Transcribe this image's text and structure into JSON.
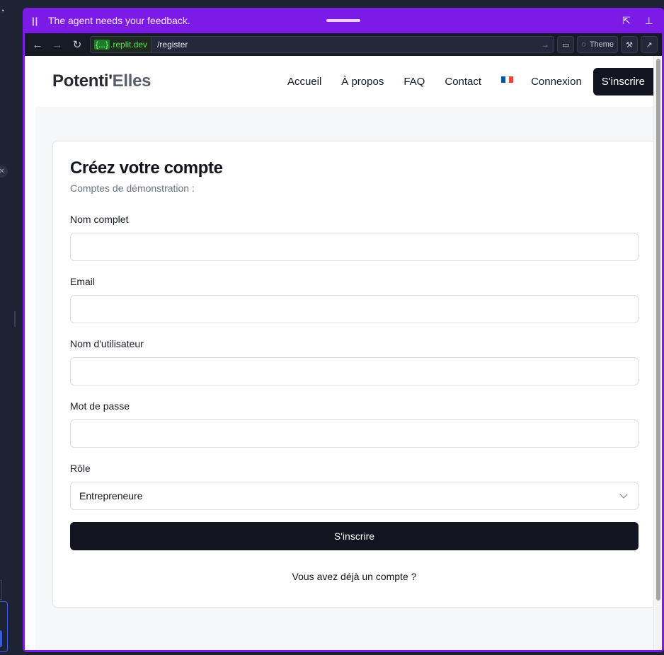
{
  "agent_bar": {
    "message": "The agent needs your feedback."
  },
  "browser": {
    "domain_brace": "{...}",
    "domain_suffix": ".replit.dev",
    "path": "/register",
    "theme_label": "Theme"
  },
  "site": {
    "logo_main": "Potenti'",
    "logo_tail": "Elles",
    "nav": {
      "home": "Accueil",
      "about": "À propos",
      "faq": "FAQ",
      "contact": "Contact",
      "login": "Connexion",
      "signup": "S'inscrire"
    },
    "flag_colors": [
      "#0055a4",
      "#ffffff",
      "#ef4135"
    ]
  },
  "register": {
    "title": "Créez votre compte",
    "subtitle": "Comptes de démonstration :",
    "fields": {
      "full_name": {
        "label": "Nom complet",
        "value": ""
      },
      "email": {
        "label": "Email",
        "value": ""
      },
      "username": {
        "label": "Nom d'utilisateur",
        "value": ""
      },
      "password": {
        "label": "Mot de passe",
        "value": ""
      },
      "role": {
        "label": "Rôle",
        "selected": "Entrepreneure"
      }
    },
    "submit_label": "S'inscrire",
    "already_account": "Vous avez déjà un compte ?"
  },
  "colors": {
    "frame_accent": "#7c1ae6",
    "primary_button": "#12141f",
    "url_domain": "#5ae05a"
  }
}
